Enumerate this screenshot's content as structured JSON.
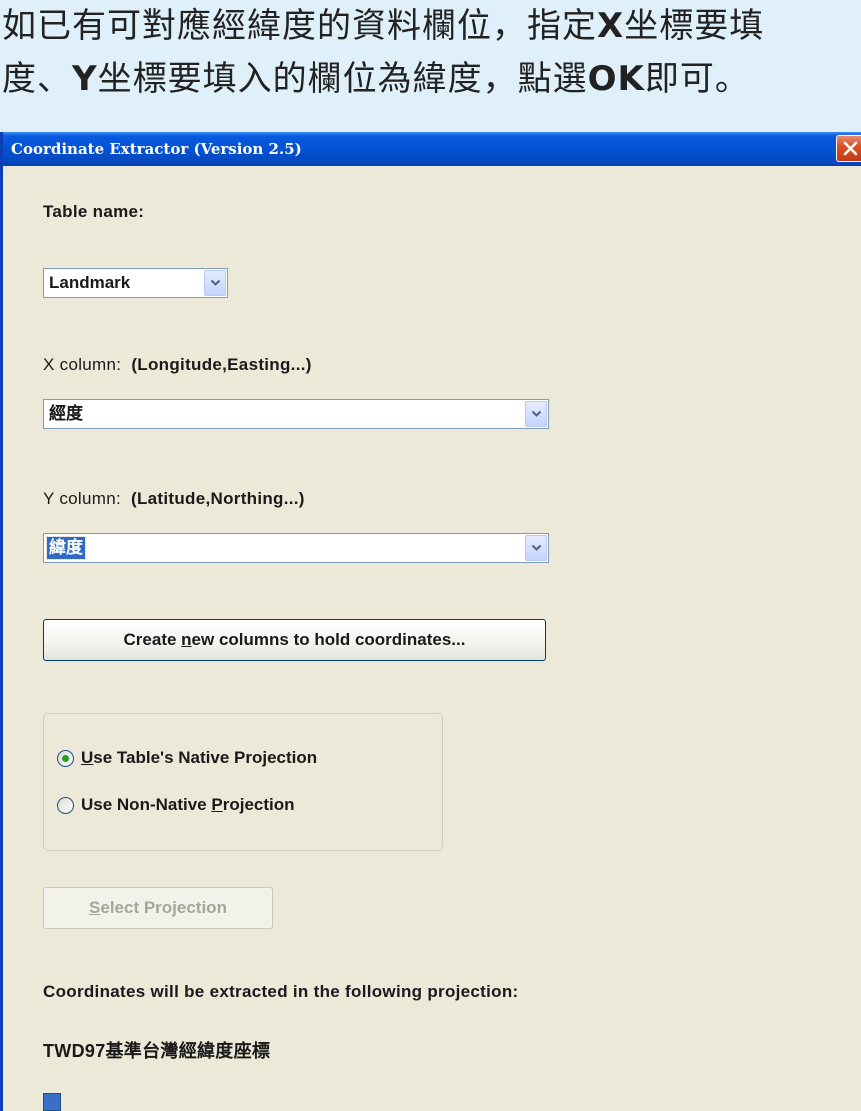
{
  "instruction": {
    "line1_parts": [
      "如已有可對應經緯度的資料欄位，指定",
      "X",
      "坐標要填"
    ],
    "line2_parts": [
      "度、",
      "Y",
      "坐標要填入的欄位為緯度，點選",
      "OK",
      "即可。"
    ]
  },
  "dialog": {
    "title": "Coordinate Extractor (Version 2.5)",
    "close_glyph": "close-icon",
    "table_name_label": "Table name:",
    "table_name_value": "Landmark",
    "x_label_prefix": "X column:",
    "x_label_hint": "(Longitude,Easting...)",
    "x_value": "經度",
    "y_label_prefix": "Y column:",
    "y_label_hint": "(Latitude,Northing...)",
    "y_value": "緯度",
    "create_button": {
      "before": "Create ",
      "accel": "n",
      "after": "ew columns to hold coordinates..."
    },
    "radio_native": {
      "accel": "U",
      "after": "se Table's Native Projection",
      "checked": true
    },
    "radio_nonnative": {
      "before": "Use Non-Native ",
      "accel": "P",
      "after": "rojection",
      "checked": false
    },
    "select_projection_button": {
      "accel": "S",
      "after": "elect Projection",
      "enabled": false
    },
    "projection_caption": "Coordinates will be extracted in the following projection:",
    "projection_name": "TWD97基準台灣經緯度座標"
  },
  "colors": {
    "titlebar": "#0453d4",
    "selection": "#316ac5",
    "dialog_bg": "#ece9d8",
    "banner_bg": "#dff0fa"
  }
}
